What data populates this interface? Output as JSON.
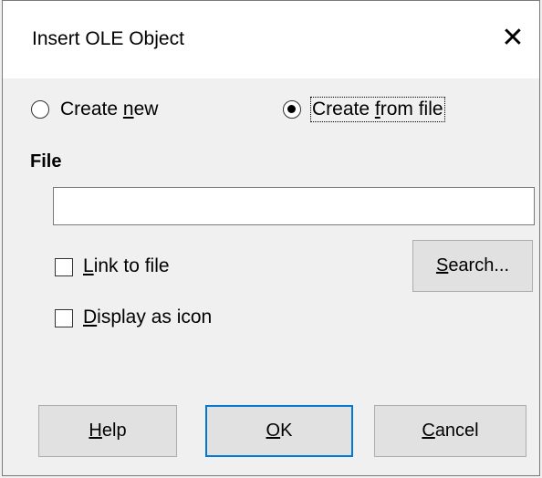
{
  "dialog": {
    "title": "Insert OLE Object",
    "close_glyph": "✕"
  },
  "options": {
    "create_new": {
      "pre": "Create ",
      "mn": "n",
      "post": "ew",
      "selected": false
    },
    "create_from_file": {
      "pre": "Create ",
      "mn": "f",
      "post": "rom file",
      "selected": true
    }
  },
  "file": {
    "heading": "File",
    "value": "",
    "placeholder": ""
  },
  "link_to_file": {
    "mn": "L",
    "post": "ink to file",
    "checked": false
  },
  "display_as_icon": {
    "mn": "D",
    "post": "isplay as icon",
    "checked": false
  },
  "search_button": {
    "mn": "S",
    "post": "earch..."
  },
  "footer": {
    "help": {
      "mn": "H",
      "post": "elp"
    },
    "ok": {
      "mn": "O",
      "post": "K"
    },
    "cancel": {
      "mn": "C",
      "post": "ancel"
    }
  },
  "icons": {
    "close": "close-x-icon"
  }
}
